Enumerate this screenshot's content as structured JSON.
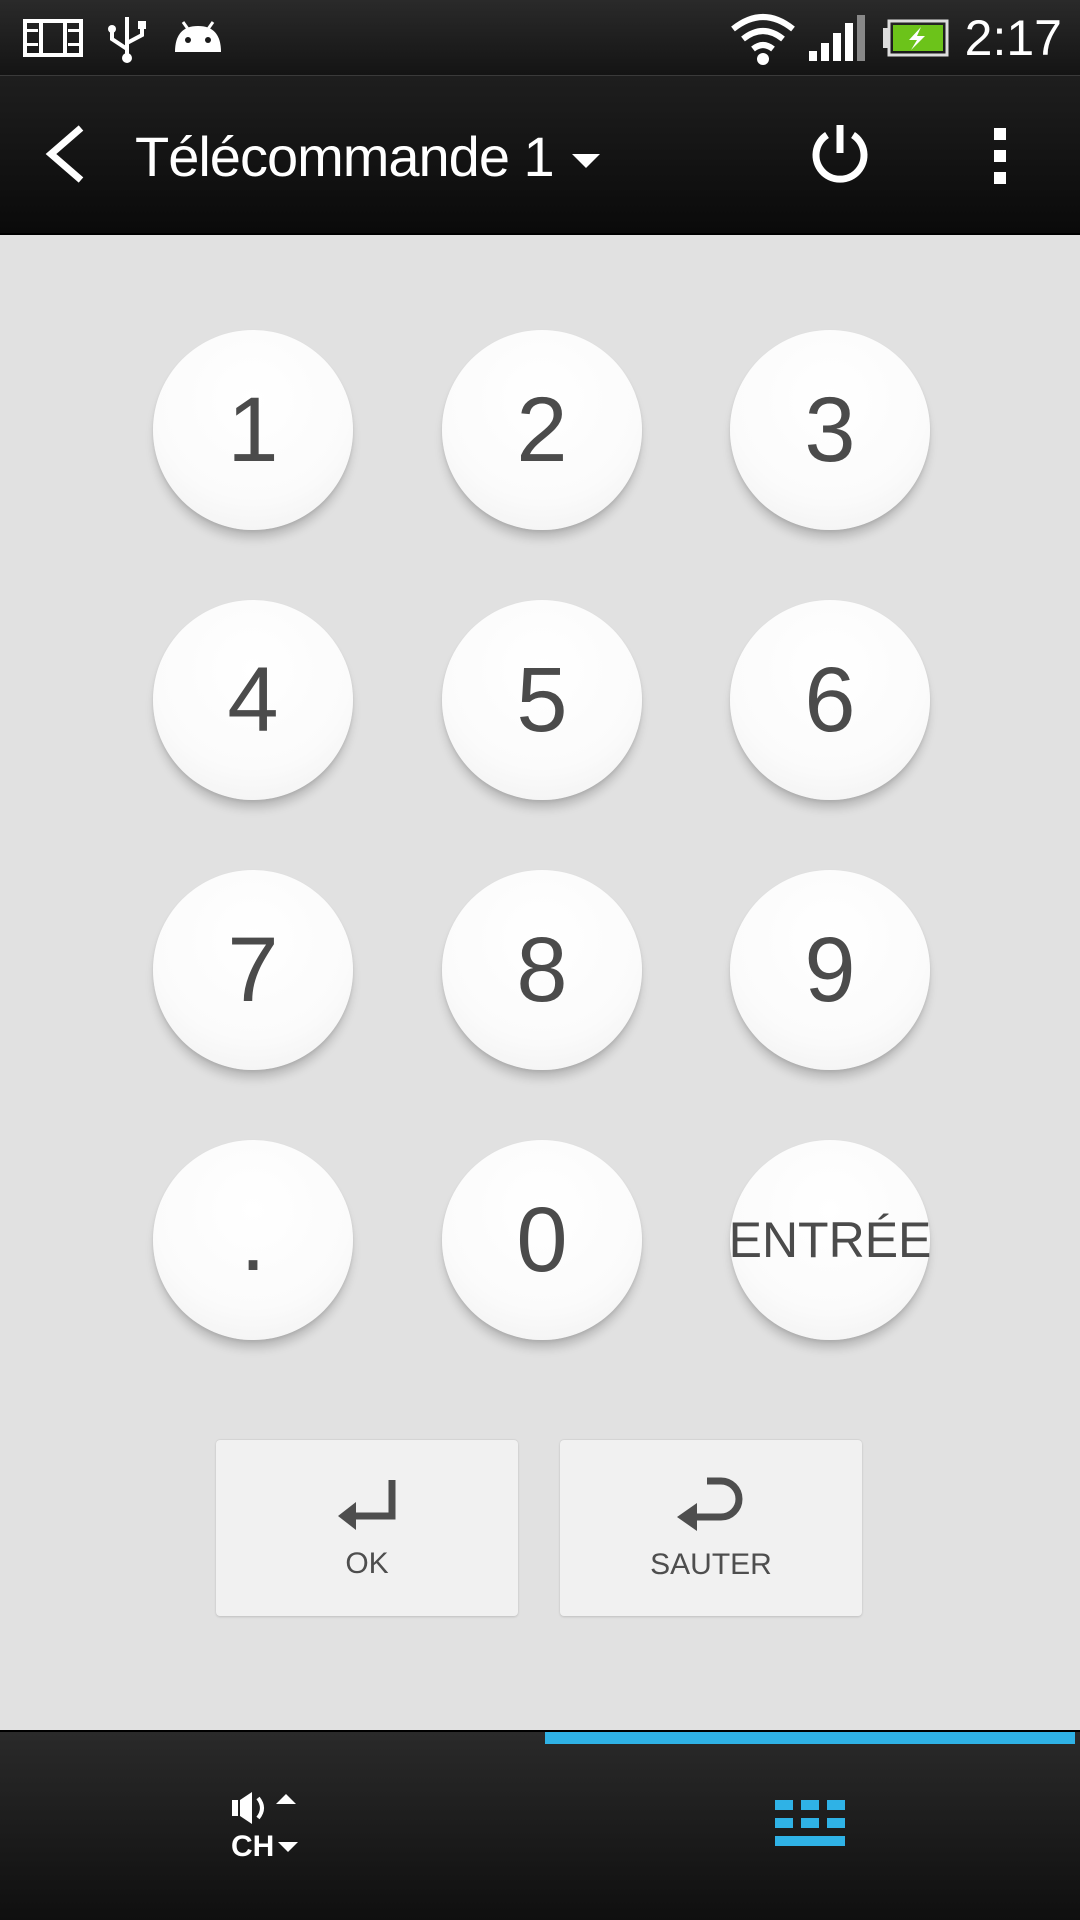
{
  "status_bar": {
    "time": "2:17",
    "icons": [
      "film-strip-icon",
      "usb-icon",
      "android-debug-icon",
      "wifi-icon",
      "signal-icon",
      "battery-charging-icon"
    ]
  },
  "action_bar": {
    "title": "Télécommande 1",
    "back_icon": "chevron-left-icon",
    "dropdown_icon": "caret-down-icon",
    "power_icon": "power-icon",
    "overflow_icon": "overflow-menu-icon"
  },
  "keypad": {
    "keys": [
      "1",
      "2",
      "3",
      "4",
      "5",
      "6",
      "7",
      "8",
      "9",
      ".",
      "0",
      "ENTRÉE"
    ]
  },
  "buttons": {
    "ok_label": "OK",
    "skip_label": "SAUTER"
  },
  "tabs": {
    "items": [
      "volume-channel-icon",
      "keypad-icon"
    ],
    "selected": "keypad",
    "accent_color": "#2fb2e6"
  }
}
